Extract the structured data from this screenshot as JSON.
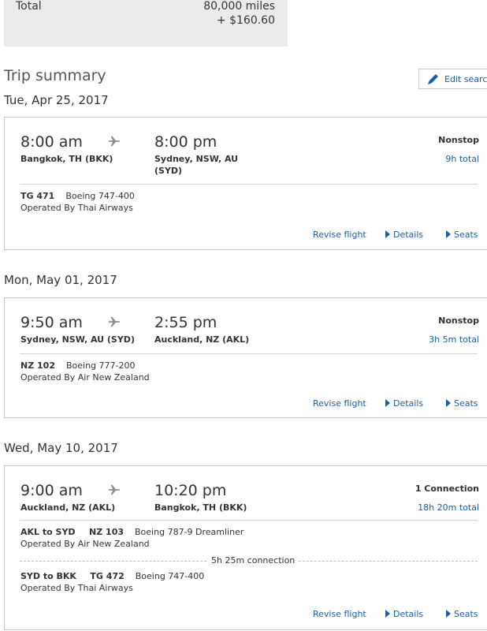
{
  "total": {
    "label": "Total",
    "miles": "80,000 miles",
    "cash": "+ $160.60"
  },
  "trip_summary": {
    "title": "Trip summary",
    "edit_search": "Edit search"
  },
  "segments": [
    {
      "date": "Tue, Apr 25, 2017",
      "depart_time": "8:00 am",
      "arrive_time": "8:00 pm",
      "origin": "Bangkok, TH (BKK)",
      "destination_line1": "Sydney, NSW, AU",
      "destination_line2": "(SYD)",
      "stops": "Nonstop",
      "duration": "9h total",
      "flight_no": "TG 471",
      "aircraft": "Boeing 747-400",
      "operated_by": "Operated By Thai Airways",
      "links": {
        "revise": "Revise flight",
        "details": "Details",
        "seats": "Seats"
      }
    },
    {
      "date": "Mon, May 01, 2017",
      "depart_time": "9:50 am",
      "arrive_time": "2:55 pm",
      "origin": "Sydney, NSW, AU (SYD)",
      "destination": "Auckland, NZ (AKL)",
      "stops": "Nonstop",
      "duration": "3h 5m total",
      "flight_no": "NZ 102",
      "aircraft": "Boeing 777-200",
      "operated_by": "Operated By Air New Zealand",
      "links": {
        "revise": "Revise flight",
        "details": "Details",
        "seats": "Seats"
      }
    },
    {
      "date": "Wed, May 10, 2017",
      "depart_time": "9:00 am",
      "arrive_time": "10:20 pm",
      "origin": "Auckland, NZ (AKL)",
      "destination": "Bangkok, TH (BKK)",
      "stops": "1 Connection",
      "duration": "18h 20m total",
      "legs": [
        {
          "route": "AKL to SYD",
          "flight_no": "NZ 103",
          "aircraft": "Boeing 787-9 Dreamliner",
          "operated_by": "Operated By Air New Zealand"
        },
        {
          "route": "SYD to BKK",
          "flight_no": "TG 472",
          "aircraft": "Boeing 747-400",
          "operated_by": "Operated By Thai Airways"
        }
      ],
      "connection": "5h 25m connection",
      "links": {
        "revise": "Revise flight",
        "details": "Details",
        "seats": "Seats"
      }
    }
  ],
  "colors": {
    "link": "#1b5ea6",
    "border": "#c8c8c8",
    "total_bg": "#ebebeb"
  },
  "icons": {
    "plane": "plane-icon",
    "edit": "pencil-icon",
    "arrow": "triangle-right-icon"
  }
}
